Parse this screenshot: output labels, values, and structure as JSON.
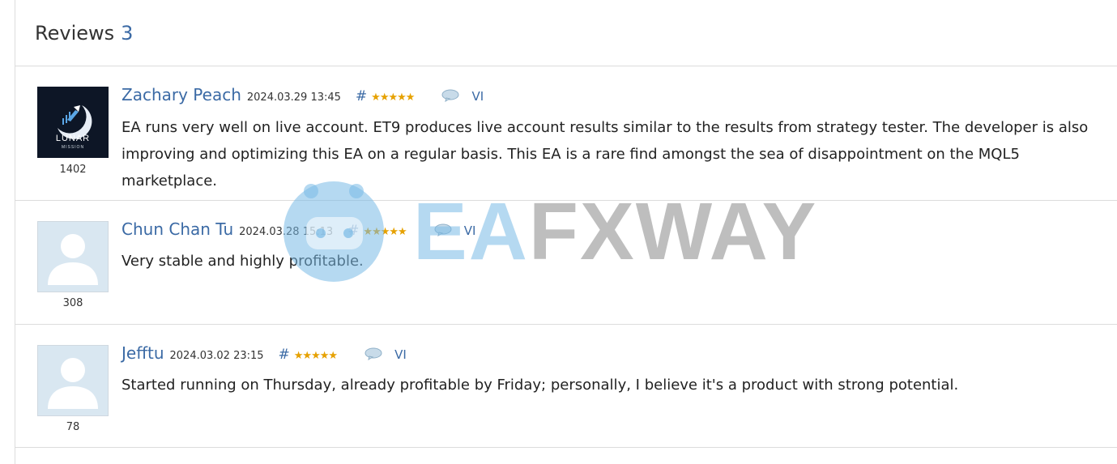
{
  "header": {
    "title": "Reviews",
    "count": "3"
  },
  "reviews": [
    {
      "author": "Zachary Peach",
      "date": "2024.03.29 13:45",
      "hash": "#",
      "stars": "★★★★★",
      "lang": "VI",
      "rating": "1402",
      "avatar": "lunar-mission-logo",
      "logo_text": "LUNAR",
      "logo_sub": "MISSION",
      "text": "EA runs very well on live account. ET9 produces live account results similar to the results from strategy tester. The developer is also improving and optimizing this EA on a regular basis. This EA is a rare find amongst the sea of disappointment on the MQL5 marketplace."
    },
    {
      "author": "Chun Chan Tu",
      "date": "2024.03.28 15:13",
      "hash": "#",
      "stars": "★★★★★",
      "lang": "VI",
      "rating": "308",
      "avatar": "default-user-avatar",
      "text": "Very stable and highly profitable."
    },
    {
      "author": "Jefftu",
      "date": "2024.03.02 23:15",
      "hash": "#",
      "stars": "★★★★★",
      "lang": "VI",
      "rating": "78",
      "avatar": "default-user-avatar",
      "text": "Started running on Thursday, already profitable by Friday; personally, I believe it's a product with strong potential."
    }
  ],
  "watermark": {
    "part1": "EA",
    "part2": "FXWAY"
  },
  "colors": {
    "link": "#3b6aa5",
    "star": "#e6a100",
    "divider": "#dcdcdc"
  }
}
